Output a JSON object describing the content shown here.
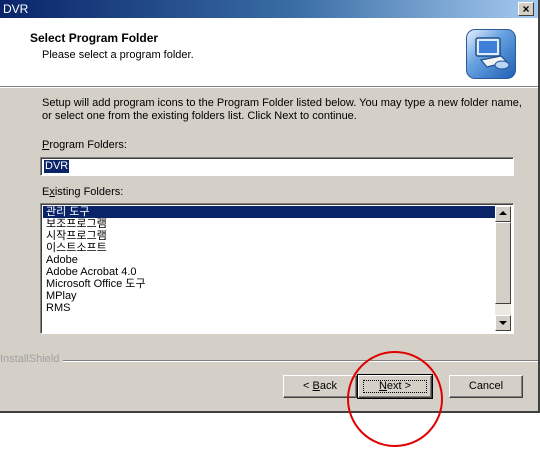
{
  "window": {
    "title": "DVR"
  },
  "header": {
    "title": "Select Program Folder",
    "subtitle": "Please select a program folder.",
    "icon": "installer-computer-icon"
  },
  "description": "Setup will add program icons to the Program Folder listed below.  You may type a new folder name, or select one from the existing folders list.  Click Next to continue.",
  "program_folder": {
    "label_mnemonic": "P",
    "label_rest": "rogram Folders:",
    "value": "DVR"
  },
  "existing_folders": {
    "label_first": "E",
    "label_mnemonic": "x",
    "label_rest": "isting Folders:",
    "items": [
      "관리 도구",
      "보조프로그램",
      "시작프로그램",
      "이스트소프트",
      "Adobe",
      "Adobe Acrobat 4.0",
      "Microsoft Office 도구",
      "MPlay",
      "RMS"
    ],
    "selected_index": 0
  },
  "footer": {
    "brand": "InstallShield"
  },
  "buttons": {
    "back_prefix": "< ",
    "back_mnemonic": "B",
    "back_rest": "ack",
    "next_mnemonic": "N",
    "next_rest": "ext >",
    "cancel": "Cancel"
  },
  "colors": {
    "dialog": "#d4d0c8",
    "selection": "#0a246a",
    "annotation_circle": "#e00000"
  }
}
